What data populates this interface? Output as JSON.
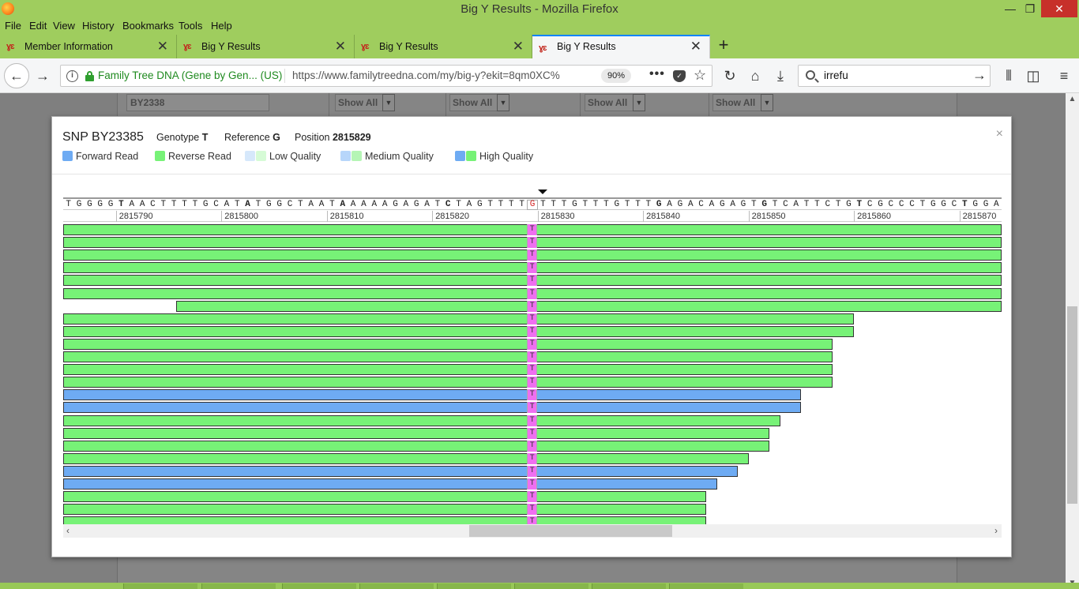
{
  "window": {
    "title": "Big Y Results - Mozilla Firefox",
    "controls": {
      "minimize": "—",
      "restore": "❐",
      "close": "✕"
    }
  },
  "menu": [
    "File",
    "Edit",
    "View",
    "History",
    "Bookmarks",
    "Tools",
    "Help"
  ],
  "tabs": [
    {
      "label": "Member Information",
      "active": false
    },
    {
      "label": "Big Y Results",
      "active": false
    },
    {
      "label": "Big Y Results",
      "active": false
    },
    {
      "label": "Big Y Results",
      "active": true
    }
  ],
  "tab_icon_glyph": "ɣɛ",
  "nav": {
    "identity": "Family Tree DNA (Gene by Gen... (US)",
    "url": "https://www.familytreedna.com/my/big-y?ekit=8qm0XC%",
    "zoom": "90%",
    "search_value": "irrefu",
    "icons": [
      "back-icon",
      "forward-icon",
      "info-icon",
      "lock-icon",
      "page-actions-icon",
      "pocket-icon",
      "bookmark-star-icon",
      "reload-icon",
      "home-icon",
      "download-icon",
      "search-icon",
      "library-icon",
      "sidebar-icon",
      "menu-icon"
    ]
  },
  "background_page": {
    "filter_value": "BY2338",
    "selects": [
      "Show All",
      "Show All",
      "Show All",
      "Show All"
    ]
  },
  "modal": {
    "snp_label": "SNP BY23385",
    "genotype_label": "Genotype",
    "genotype_value": "T",
    "reference_label": "Reference",
    "reference_value": "G",
    "position_label": "Position",
    "position_value": "2815829",
    "close_glyph": "×",
    "legend": [
      {
        "label": "Forward Read",
        "colors": [
          "#6eabf3"
        ]
      },
      {
        "label": "Reverse Read",
        "colors": [
          "#77f277"
        ]
      },
      {
        "label": "Low Quality",
        "colors": [
          "#d6e8fb",
          "#d6fbd6"
        ]
      },
      {
        "label": "Medium Quality",
        "colors": [
          "#b7d6fa",
          "#b5f5b5"
        ]
      },
      {
        "label": "High Quality",
        "colors": [
          "#6eabf3",
          "#77f277"
        ]
      }
    ]
  },
  "alignment": {
    "reference_sequence": "TGGGGTAACTTTTGCATATGGCTAATAAAAAGAGATCTAGTTTTGTTTGTTTGTTTGAGACAGAGTGTCATTCTGTCGCCCTGGCTGGA",
    "bold_positions": [
      5,
      17,
      26,
      36,
      56,
      66,
      75,
      85
    ],
    "variant_index": 44,
    "ruler_labels": [
      "2815790",
      "2815800",
      "2815810",
      "2815820",
      "2815830",
      "2815840",
      "2815850",
      "2815860",
      "2815870"
    ],
    "read_base": "T",
    "reads": [
      {
        "strand": "reverse",
        "start": 0,
        "end": 89
      },
      {
        "strand": "reverse",
        "start": 0,
        "end": 89
      },
      {
        "strand": "reverse",
        "start": 0,
        "end": 89
      },
      {
        "strand": "reverse",
        "start": 0,
        "end": 89
      },
      {
        "strand": "reverse",
        "start": 0,
        "end": 89
      },
      {
        "strand": "reverse",
        "start": 0,
        "end": 89
      },
      {
        "strand": "reverse",
        "start": 10.75,
        "end": 89
      },
      {
        "strand": "reverse",
        "start": 0,
        "end": 75
      },
      {
        "strand": "reverse",
        "start": 0,
        "end": 75
      },
      {
        "strand": "reverse",
        "start": 0,
        "end": 73
      },
      {
        "strand": "reverse",
        "start": 0,
        "end": 73
      },
      {
        "strand": "reverse",
        "start": 0,
        "end": 73
      },
      {
        "strand": "reverse",
        "start": 0,
        "end": 73
      },
      {
        "strand": "forward",
        "start": 0,
        "end": 70
      },
      {
        "strand": "forward",
        "start": 0,
        "end": 70
      },
      {
        "strand": "reverse",
        "start": 0,
        "end": 68
      },
      {
        "strand": "reverse",
        "start": 0,
        "end": 67
      },
      {
        "strand": "reverse",
        "start": 0,
        "end": 67
      },
      {
        "strand": "reverse",
        "start": 0,
        "end": 65
      },
      {
        "strand": "forward",
        "start": 0,
        "end": 64
      },
      {
        "strand": "forward",
        "start": 0,
        "end": 62
      },
      {
        "strand": "reverse",
        "start": 0,
        "end": 61
      },
      {
        "strand": "reverse",
        "start": 0,
        "end": 61
      },
      {
        "strand": "reverse",
        "start": 0,
        "end": 61
      }
    ]
  }
}
